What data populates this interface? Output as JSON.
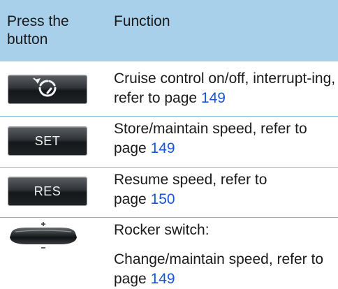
{
  "header": {
    "col1": "Press the button",
    "col2": "Function"
  },
  "rows": [
    {
      "button_icon": "cruise-control-icon",
      "text": "Cruise control on/off, interrupt-ing, refer to page ",
      "page": "149"
    },
    {
      "button_label": "SET",
      "text": "Store/maintain speed, refer to page ",
      "page": "149"
    },
    {
      "button_label": "RES",
      "text": "Resume speed, refer to page ",
      "page": "150"
    },
    {
      "button_icon": "rocker-switch-icon",
      "line1": "Rocker switch:",
      "text": "Change/maintain speed, refer to page ",
      "page": "149"
    }
  ],
  "colors": {
    "header_bg": "#a9d0ea",
    "link": "#1a54d6",
    "divider": "#7fb2d6"
  }
}
